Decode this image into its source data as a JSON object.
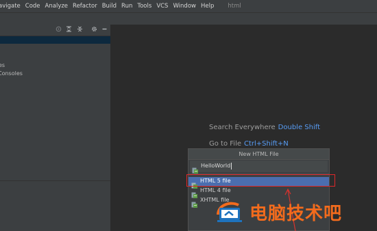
{
  "menubar": {
    "items": [
      "avigate",
      "Code",
      "Analyze",
      "Refactor",
      "Build",
      "Run",
      "Tools",
      "VCS",
      "Window",
      "Help"
    ],
    "title": "html"
  },
  "project_panel": {
    "tree": [
      {
        "label": "es"
      },
      {
        "label": "Consoles"
      }
    ]
  },
  "editor": {
    "hints": [
      {
        "label": "Search Everywhere",
        "shortcut": "Double Shift"
      },
      {
        "label": "Go to File",
        "shortcut": "Ctrl+Shift+N"
      }
    ]
  },
  "popup": {
    "title": "New HTML File",
    "name_value": "HelloWorld",
    "options": [
      {
        "label": "HTML 5 file",
        "selected": true
      },
      {
        "label": "HTML 4 file",
        "selected": false
      },
      {
        "label": "XHTML file",
        "selected": false
      }
    ]
  },
  "watermark": {
    "text": "电脑技术吧"
  },
  "colors": {
    "accent_selection": "#4b6eaf",
    "shortcut": "#589df6",
    "highlight": "#e0272a",
    "watermark": "#f26b1d"
  },
  "icons": {
    "header": [
      "locate-icon",
      "expand-all-icon",
      "collapse-all-icon",
      "gear-icon",
      "hide-icon"
    ],
    "file": "html-file-icon"
  }
}
